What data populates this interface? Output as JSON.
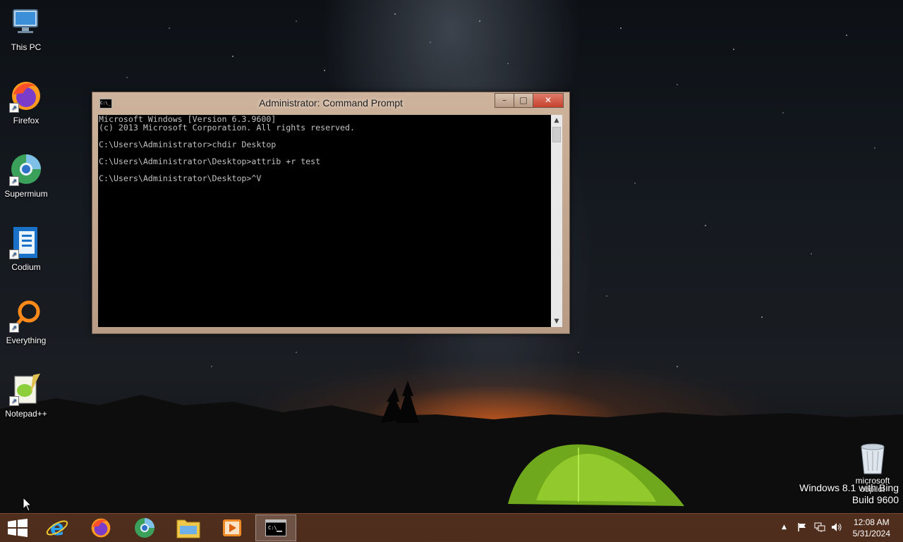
{
  "desktop_icons": [
    {
      "label": "This PC",
      "icon": "this-pc-icon"
    },
    {
      "label": "Firefox",
      "icon": "firefox-icon"
    },
    {
      "label": "Supermium",
      "icon": "supermium-icon"
    },
    {
      "label": "Codium",
      "icon": "codium-icon"
    },
    {
      "label": "Everything",
      "icon": "everything-icon"
    },
    {
      "label": "Notepad++",
      "icon": "notepadpp-icon"
    }
  ],
  "cmd_window": {
    "title": "Administrator: Command Prompt",
    "buttons": {
      "minimize": "–",
      "maximize": "□",
      "close": "✕"
    },
    "console_text": "Microsoft Windows [Version 6.3.9600]\n(c) 2013 Microsoft Corporation. All rights reserved.\n\nC:\\Users\\Administrator>chdir Desktop\n\nC:\\Users\\Administrator\\Desktop>attrib +r test\n\nC:\\Users\\Administrator\\Desktop>^V"
  },
  "recycle_bin": {
    "label_line1": "microsoft",
    "label_line2": "copilot"
  },
  "watermark": {
    "line1": "Windows 8.1 with Bing",
    "line2": "Build 9600"
  },
  "taskbar": {
    "apps": [
      "start-icon",
      "internet-explorer-icon",
      "firefox-icon",
      "supermium-icon",
      "file-explorer-icon",
      "media-player-icon",
      "command-prompt-icon"
    ],
    "active_app": "command-prompt-icon"
  },
  "clock": {
    "time": "12:08 AM",
    "date": "5/31/2024"
  },
  "colors": {
    "taskbar": "#55301e",
    "window_frame": "#c4a890",
    "close_button": "#c6412d"
  }
}
